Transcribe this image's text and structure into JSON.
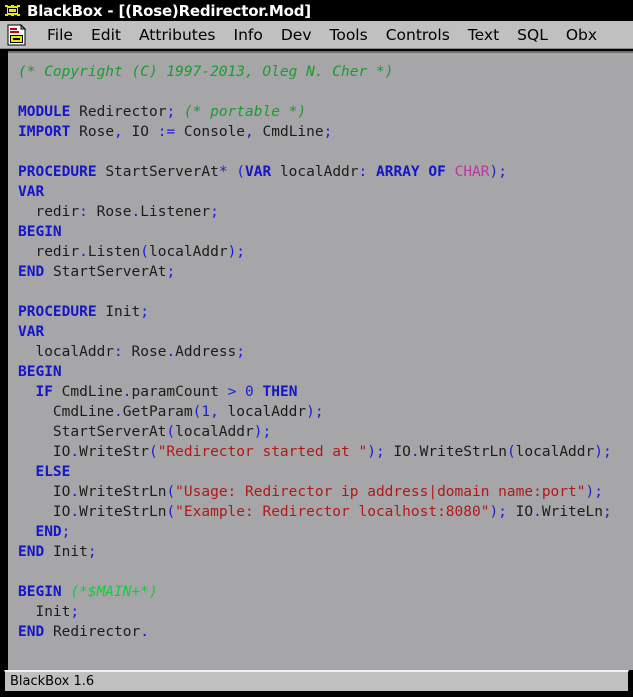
{
  "window": {
    "title": "BlackBox - [(Rose)Redirector.Mod]",
    "app_icon": "blackbox-app-icon",
    "document_icon": "document-icon"
  },
  "menubar": {
    "items": [
      {
        "label": "File"
      },
      {
        "label": "Edit"
      },
      {
        "label": "Attributes"
      },
      {
        "label": "Info"
      },
      {
        "label": "Dev"
      },
      {
        "label": "Tools"
      },
      {
        "label": "Controls"
      },
      {
        "label": "Text"
      },
      {
        "label": "SQL"
      },
      {
        "label": "Obx"
      }
    ]
  },
  "statusbar": {
    "text": "BlackBox 1.6"
  },
  "colors": {
    "titlebar_bg": "#000000",
    "titlebar_fg": "#ffffff",
    "menubar_bg": "#c0c0c0",
    "code_bg": "#a6a6a8",
    "keyword": "#1414c8",
    "punctuation": "#1b1bdc",
    "string": "#b01818",
    "comment": "#1d9b33",
    "comment_bright": "#16cc3a",
    "type": "#c0349d",
    "identifier": "#1c1c1c",
    "statusbar_bg": "#c0c0c0"
  },
  "code": {
    "language": "Component Pascal (Oberon)",
    "lines": [
      {
        "n": 1,
        "text": "(* Copyright (C) 1997-2013, Oleg N. Cher *)"
      },
      {
        "n": 2,
        "text": ""
      },
      {
        "n": 3,
        "text": "MODULE Redirector; (* portable *)"
      },
      {
        "n": 4,
        "text": "IMPORT Rose, IO := Console, CmdLine;"
      },
      {
        "n": 5,
        "text": ""
      },
      {
        "n": 6,
        "text": "PROCEDURE StartServerAt* (VAR localAddr: ARRAY OF CHAR);"
      },
      {
        "n": 7,
        "text": "VAR"
      },
      {
        "n": 8,
        "text": "  redir: Rose.Listener;"
      },
      {
        "n": 9,
        "text": "BEGIN"
      },
      {
        "n": 10,
        "text": "  redir.Listen(localAddr);"
      },
      {
        "n": 11,
        "text": "END StartServerAt;"
      },
      {
        "n": 12,
        "text": ""
      },
      {
        "n": 13,
        "text": "PROCEDURE Init;"
      },
      {
        "n": 14,
        "text": "VAR"
      },
      {
        "n": 15,
        "text": "  localAddr: Rose.Address;"
      },
      {
        "n": 16,
        "text": "BEGIN"
      },
      {
        "n": 17,
        "text": "  IF CmdLine.paramCount > 0 THEN"
      },
      {
        "n": 18,
        "text": "    CmdLine.GetParam(1, localAddr);"
      },
      {
        "n": 19,
        "text": "    StartServerAt(localAddr);"
      },
      {
        "n": 20,
        "text": "    IO.WriteStr(\"Redirector started at \"); IO.WriteStrLn(localAddr);"
      },
      {
        "n": 21,
        "text": "  ELSE"
      },
      {
        "n": 22,
        "text": "    IO.WriteStrLn(\"Usage: Redirector ip address|domain name:port\");"
      },
      {
        "n": 23,
        "text": "    IO.WriteStrLn(\"Example: Redirector localhost:8080\"); IO.WriteLn;"
      },
      {
        "n": 24,
        "text": "  END;"
      },
      {
        "n": 25,
        "text": "END Init;"
      },
      {
        "n": 26,
        "text": ""
      },
      {
        "n": 27,
        "text": "BEGIN (*$MAIN+*)"
      },
      {
        "n": 28,
        "text": "  Init;"
      },
      {
        "n": 29,
        "text": "END Redirector."
      }
    ],
    "strings": [
      "Redirector started at ",
      "Usage: Redirector ip address|domain name:port",
      "Example: Redirector localhost:8080"
    ],
    "comments": [
      "(* Copyright (C) 1997-2013, Oleg N. Cher *)",
      "(* portable *)",
      "(*$MAIN+*)"
    ],
    "keywords_used": [
      "MODULE",
      "IMPORT",
      "PROCEDURE",
      "VAR",
      "BEGIN",
      "END",
      "ARRAY",
      "OF",
      "IF",
      "THEN",
      "ELSE"
    ]
  }
}
